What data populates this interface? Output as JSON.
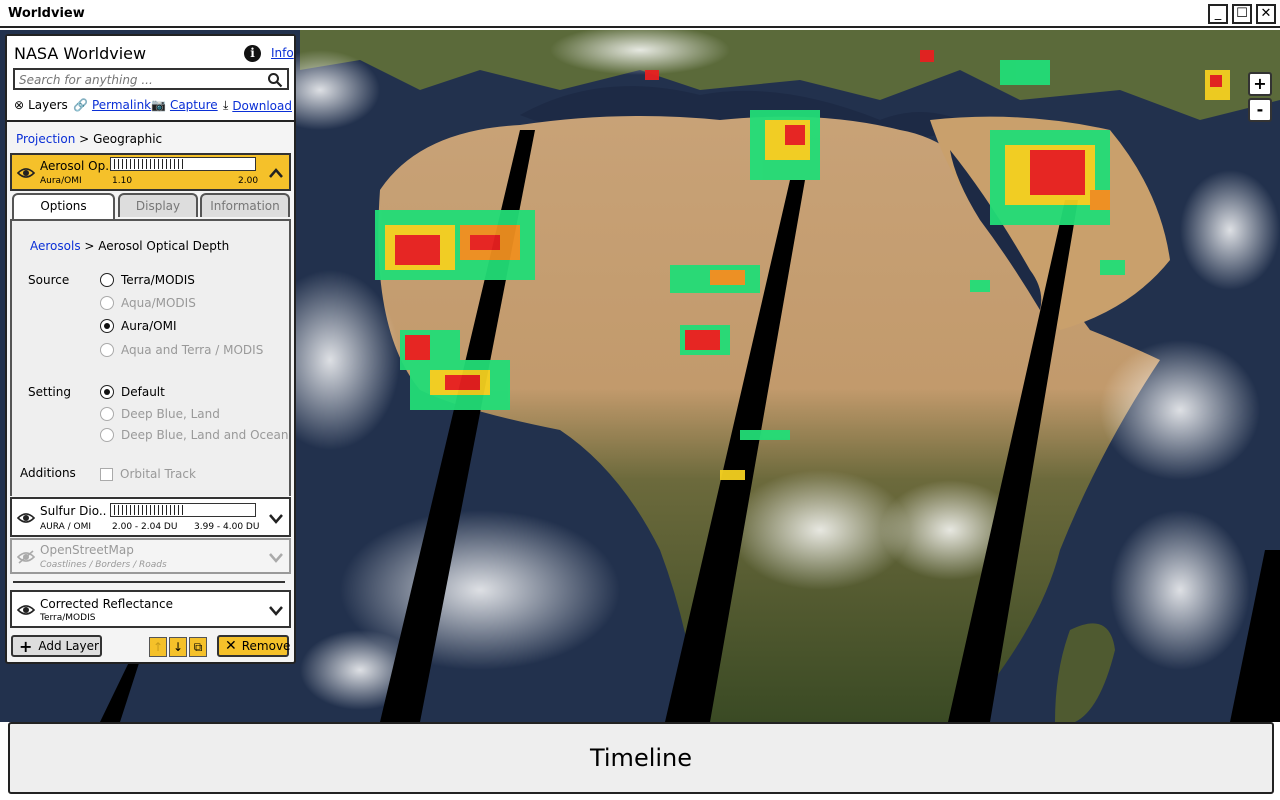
{
  "window": {
    "title": "Worldview",
    "min_label": "_",
    "max_label": "☐",
    "close_label": "✕"
  },
  "header": {
    "app_title": "NASA Worldview",
    "info_label": "Info",
    "search_placeholder": "Search for anything ...",
    "tools": {
      "layers": "Layers",
      "permalink": "Permalink",
      "capture": "Capture",
      "download": "Download"
    }
  },
  "projection": {
    "label": "Projection",
    "separator": ">",
    "value": "Geographic"
  },
  "active_layer": {
    "name": "Aerosol Op..",
    "source": "Aura/OMI",
    "legend_min": "1.10",
    "legend_max": "2.00"
  },
  "tabs": {
    "options": "Options",
    "display": "Display",
    "information": "Information",
    "active": "options"
  },
  "options": {
    "breadcrumb_root": "Aerosols",
    "breadcrumb_sep": ">",
    "breadcrumb_leaf": "Aerosol Optical Depth",
    "source_label": "Source",
    "sources": [
      {
        "label": "Terra/MODIS",
        "selected": false,
        "enabled": true
      },
      {
        "label": "Aqua/MODIS",
        "selected": false,
        "enabled": false
      },
      {
        "label": "Aura/OMI",
        "selected": true,
        "enabled": true
      },
      {
        "label": "Aqua and Terra / MODIS",
        "selected": false,
        "enabled": false
      }
    ],
    "setting_label": "Setting",
    "settings": [
      {
        "label": "Default",
        "selected": true,
        "enabled": true
      },
      {
        "label": "Deep Blue, Land",
        "selected": false,
        "enabled": false
      },
      {
        "label": "Deep Blue, Land and Ocean",
        "selected": false,
        "enabled": false
      }
    ],
    "additions_label": "Additions",
    "additions": [
      {
        "label": "Orbital Track",
        "checked": false,
        "enabled": false
      }
    ]
  },
  "layers": [
    {
      "name": "Sulfur Dio..",
      "source": "AURA / OMI",
      "range_low": "2.00 - 2.04 DU",
      "range_high": "3.99 - 4.00 DU",
      "visible": true
    },
    {
      "name": "OpenStreetMap",
      "source": "Coastlines / Borders / Roads",
      "visible": false
    },
    {
      "name": "Corrected Reflectance",
      "source": "Terra/MODIS",
      "visible": true
    }
  ],
  "footer": {
    "add_layer": "Add Layer",
    "move_up": "↑",
    "move_down": "↓",
    "duplicate": "⧉",
    "remove": "Remove"
  },
  "map_controls": {
    "zoom_in": "+",
    "zoom_out": "-"
  },
  "timeline": {
    "label": "Timeline"
  },
  "colors": {
    "accent_yellow": "#f5c12a",
    "link_blue": "#0a2fd6"
  }
}
